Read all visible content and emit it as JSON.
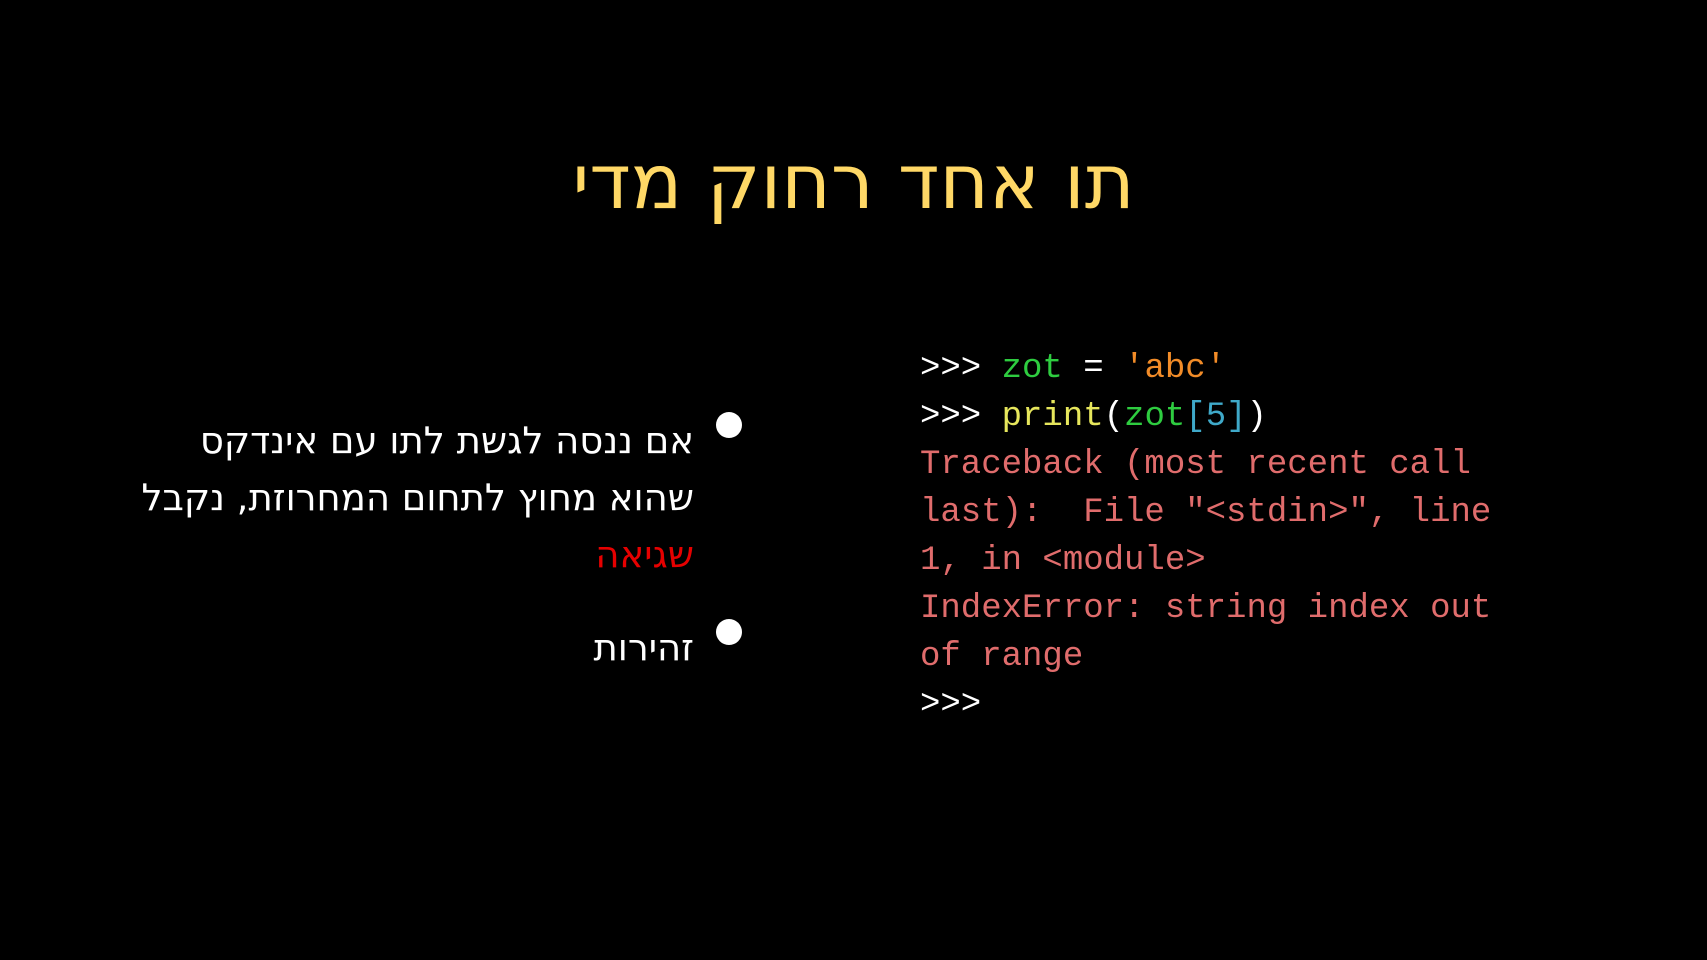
{
  "title": {
    "text": "תו אחד רחוק מדי",
    "color": "#ffd866"
  },
  "bullets": [
    {
      "text": "אם ננסה לגשת לתו עם אינדקס שהוא מחוץ לתחום המחרוזת, נקבל",
      "highlight": "שגיאה",
      "highlight_color": "#e60000"
    },
    {
      "text": "זהירות"
    }
  ],
  "code": {
    "colors": {
      "prompt": "#ffffff",
      "variable": "#2ecc40",
      "string": "#f28c28",
      "function": "#e6e65c",
      "bracket": "#3fa9c9",
      "number": "#3fa9c9",
      "error": "#e06c6c"
    },
    "lines": [
      [
        {
          "text": ">>> ",
          "kind": "prompt"
        },
        {
          "text": "zot",
          "kind": "variable"
        },
        {
          "text": " = ",
          "kind": "prompt"
        },
        {
          "text": "'abc'",
          "kind": "string"
        }
      ],
      [
        {
          "text": ">>> ",
          "kind": "prompt"
        },
        {
          "text": "print",
          "kind": "function"
        },
        {
          "text": "(",
          "kind": "prompt"
        },
        {
          "text": "zot",
          "kind": "variable"
        },
        {
          "text": "[",
          "kind": "bracket"
        },
        {
          "text": "5",
          "kind": "number"
        },
        {
          "text": "]",
          "kind": "bracket"
        },
        {
          "text": ")",
          "kind": "prompt"
        }
      ],
      [
        {
          "text": "Traceback (most recent call",
          "kind": "error"
        }
      ],
      [
        {
          "text": "last):  File \"<stdin>\", line",
          "kind": "error"
        }
      ],
      [
        {
          "text": "1, in <module>",
          "kind": "error"
        }
      ],
      [
        {
          "text": "IndexError: string index out",
          "kind": "error"
        }
      ],
      [
        {
          "text": "of range",
          "kind": "error"
        }
      ],
      [
        {
          "text": ">>>",
          "kind": "prompt"
        }
      ]
    ]
  }
}
